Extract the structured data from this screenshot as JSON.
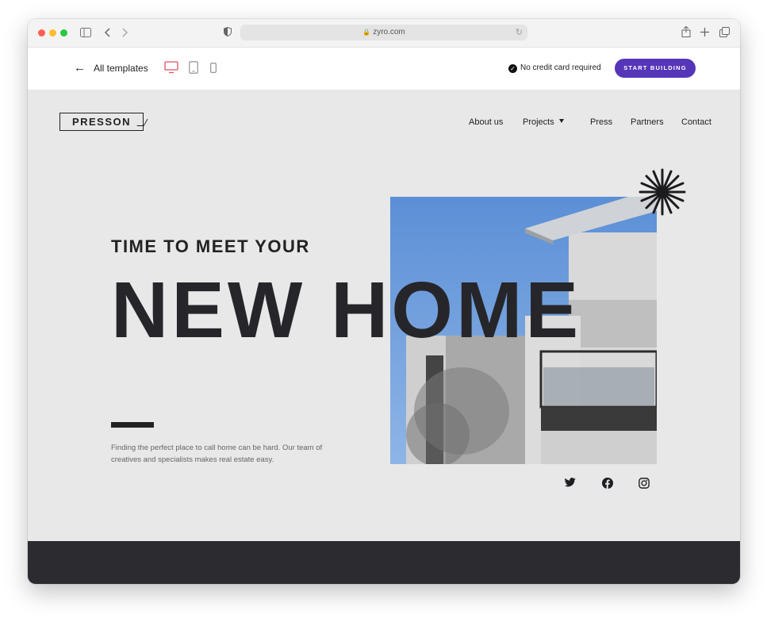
{
  "browser": {
    "url": "zyro.com",
    "icons": [
      "sidebar-icon",
      "back-icon",
      "forward-icon",
      "shield-icon",
      "lock-icon",
      "reload-icon",
      "share-icon",
      "new-tab-icon",
      "tabs-icon"
    ]
  },
  "editor_bar": {
    "back_label": "All templates",
    "devices": [
      "desktop-icon",
      "tablet-icon",
      "mobile-icon"
    ],
    "no_card_text": "No credit card required",
    "start_label": "START BUILDING",
    "accent": "#5535b8",
    "active_device_color": "#e0505a"
  },
  "site": {
    "logo": "PRESSON",
    "nav": {
      "about": "About us",
      "projects": "Projects",
      "press": "Press",
      "partners": "Partners",
      "contact": "Contact"
    },
    "hero": {
      "tagline": "TIME TO MEET YOUR",
      "headline": "NEW HOME",
      "description": "Finding the perfect place to call home can be hard. Our team of creatives and specialists makes real estate easy."
    },
    "social": [
      "twitter-icon",
      "facebook-icon",
      "instagram-icon"
    ],
    "colors": {
      "background": "#e8e8e8",
      "text": "#26262a",
      "footer": "#2b2b30"
    }
  }
}
